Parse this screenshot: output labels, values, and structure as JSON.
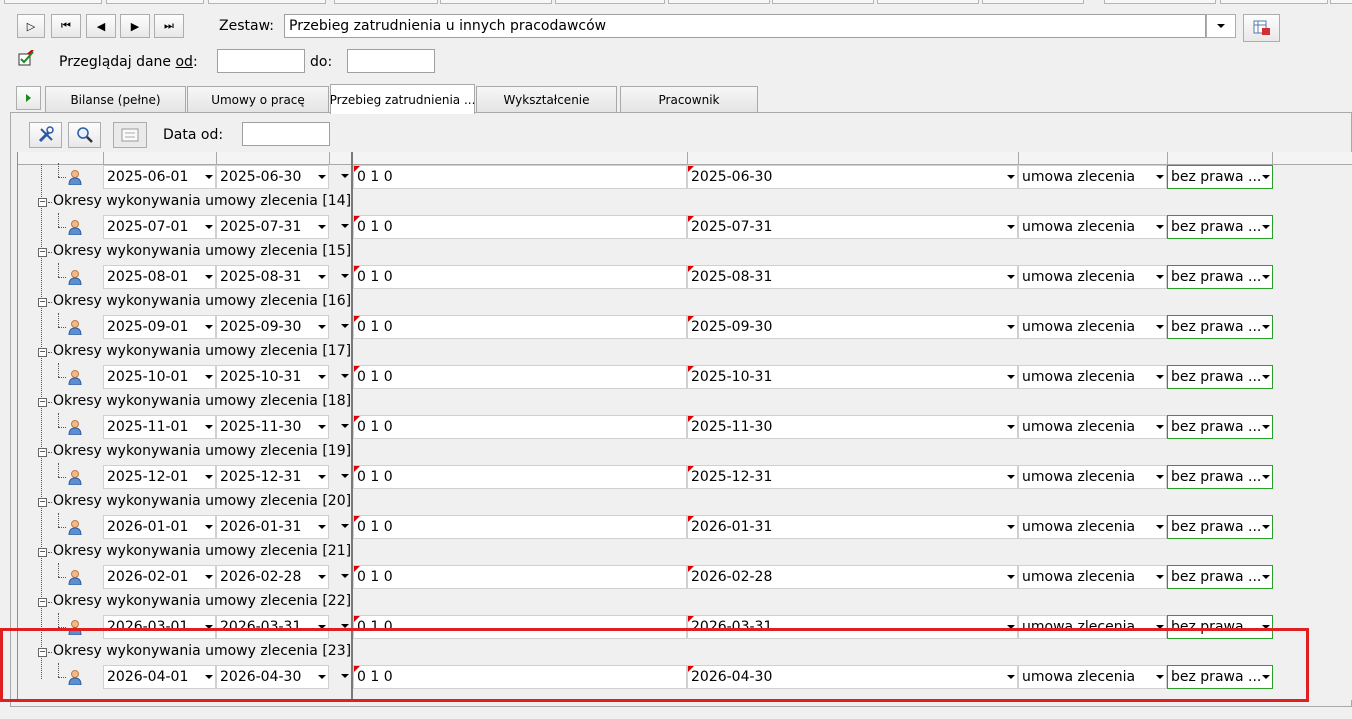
{
  "toolbar": {
    "first_symbol": "▷",
    "nav_first": "⏮",
    "nav_prev": "◀",
    "nav_next": "▶",
    "nav_last": "⏭",
    "zestaw_label": "Zestaw:",
    "zestaw_value": "Przebieg zatrudnienia u innych pracodawców"
  },
  "filter": {
    "label_prefix": "Przeglądaj dane ",
    "label_od": "od",
    "label_suffix": ":",
    "from_value": "",
    "to_label": "do:",
    "to_value": ""
  },
  "tabs": [
    {
      "label": "Bilanse (pełne)"
    },
    {
      "label": "Umowy o pracę"
    },
    {
      "label": "Przebieg zatrudnienia ..."
    },
    {
      "label": "Wykształcenie"
    },
    {
      "label": "Pracownik"
    }
  ],
  "inner_toolbar": {
    "data_od_label": "Data od:",
    "data_od_value": ""
  },
  "colors": {
    "highlight": "#e02020",
    "green_border": "#2aa02a"
  },
  "rows": [
    {
      "group": null,
      "from": "2025-06-01",
      "to": "2025-06-30",
      "code": "0  1  0",
      "end": "2025-06-30",
      "type": "umowa zlecenia",
      "right": "bez prawa ..."
    },
    {
      "group": "Okresy wykonywania umowy zlecenia [14]",
      "from": "2025-07-01",
      "to": "2025-07-31",
      "code": "0  1  0",
      "end": "2025-07-31",
      "type": "umowa zlecenia",
      "right": "bez prawa ..."
    },
    {
      "group": "Okresy wykonywania umowy zlecenia [15]",
      "from": "2025-08-01",
      "to": "2025-08-31",
      "code": "0  1  0",
      "end": "2025-08-31",
      "type": "umowa zlecenia",
      "right": "bez prawa ..."
    },
    {
      "group": "Okresy wykonywania umowy zlecenia [16]",
      "from": "2025-09-01",
      "to": "2025-09-30",
      "code": "0  1  0",
      "end": "2025-09-30",
      "type": "umowa zlecenia",
      "right": "bez prawa ..."
    },
    {
      "group": "Okresy wykonywania umowy zlecenia [17]",
      "from": "2025-10-01",
      "to": "2025-10-31",
      "code": "0  1  0",
      "end": "2025-10-31",
      "type": "umowa zlecenia",
      "right": "bez prawa ..."
    },
    {
      "group": "Okresy wykonywania umowy zlecenia [18]",
      "from": "2025-11-01",
      "to": "2025-11-30",
      "code": "0  1  0",
      "end": "2025-11-30",
      "type": "umowa zlecenia",
      "right": "bez prawa ..."
    },
    {
      "group": "Okresy wykonywania umowy zlecenia [19]",
      "from": "2025-12-01",
      "to": "2025-12-31",
      "code": "0  1  0",
      "end": "2025-12-31",
      "type": "umowa zlecenia",
      "right": "bez prawa ..."
    },
    {
      "group": "Okresy wykonywania umowy zlecenia [20]",
      "from": "2026-01-01",
      "to": "2026-01-31",
      "code": "0  1  0",
      "end": "2026-01-31",
      "type": "umowa zlecenia",
      "right": "bez prawa ..."
    },
    {
      "group": "Okresy wykonywania umowy zlecenia [21]",
      "from": "2026-02-01",
      "to": "2026-02-28",
      "code": "0  1  0",
      "end": "2026-02-28",
      "type": "umowa zlecenia",
      "right": "bez prawa ..."
    },
    {
      "group": "Okresy wykonywania umowy zlecenia [22]",
      "from": "2026-03-01",
      "to": "2026-03-31",
      "code": "0  1  0",
      "end": "2026-03-31",
      "type": "umowa zlecenia",
      "right": "bez prawa ..."
    },
    {
      "group": "Okresy wykonywania umowy zlecenia [23]",
      "from": "2026-04-01",
      "to": "2026-04-30",
      "code": "0  1  0",
      "end": "2026-04-30",
      "type": "umowa zlecenia",
      "right": "bez prawa ..."
    }
  ]
}
